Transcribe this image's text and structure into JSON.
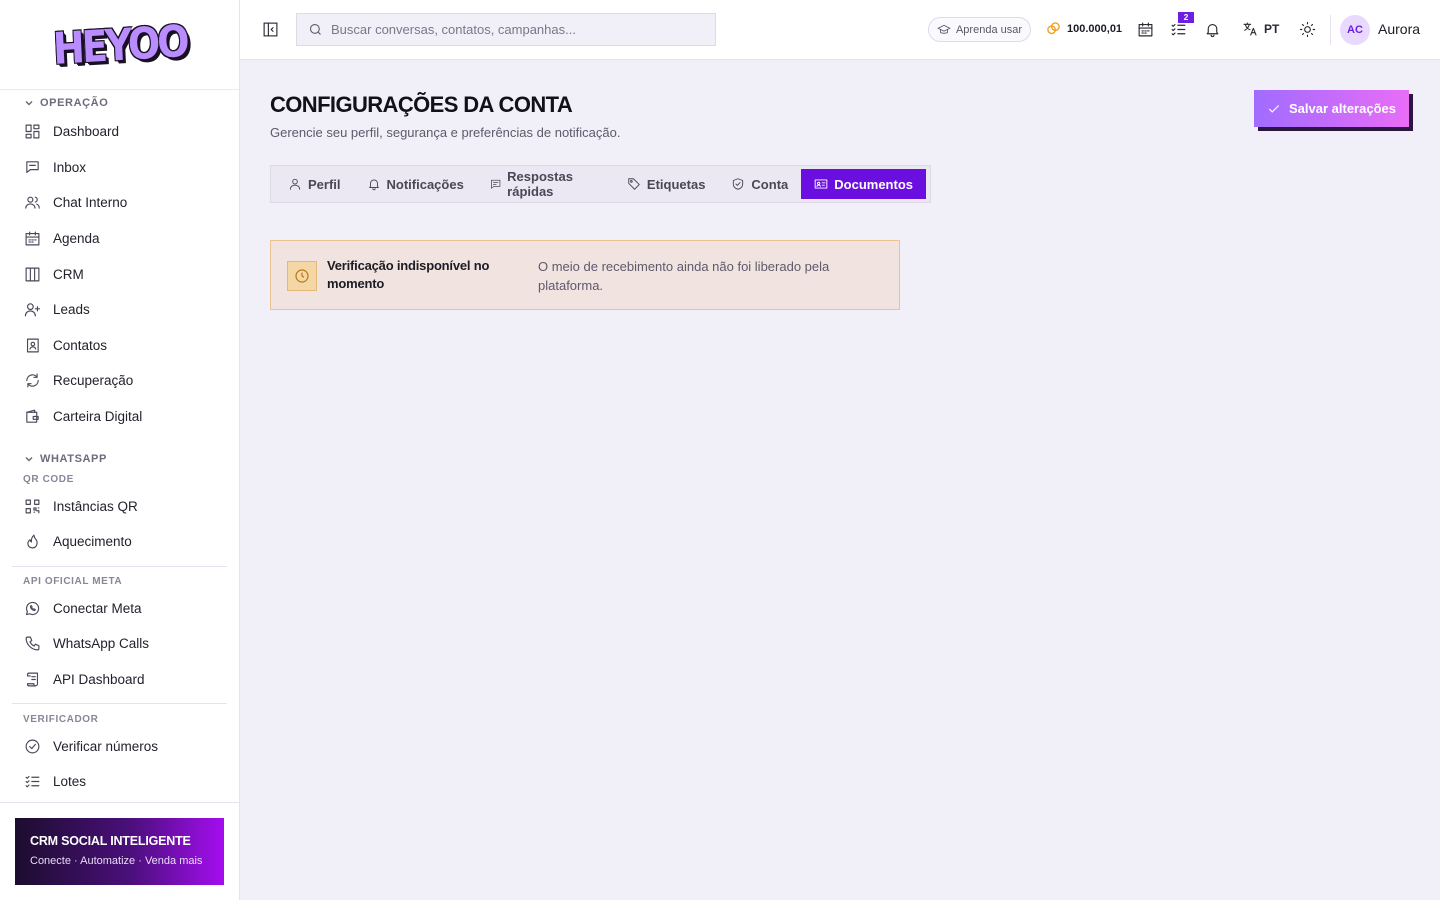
{
  "sidebar": {
    "logo_text": "HEYOO",
    "sections": {
      "operacao": "OPERAÇÃO",
      "whatsapp": "WHATSAPP",
      "qr_code": "QR CODE",
      "api_meta": "API OFICIAL META",
      "verificador": "VERIFICADOR"
    },
    "items": {
      "dashboard": "Dashboard",
      "inbox": "Inbox",
      "chat_interno": "Chat Interno",
      "agenda": "Agenda",
      "crm": "CRM",
      "leads": "Leads",
      "contatos": "Contatos",
      "recuperacao": "Recuperação",
      "carteira": "Carteira Digital",
      "instancias": "Instâncias QR",
      "aquecimento": "Aquecimento",
      "conectar_meta": "Conectar Meta",
      "whatsapp_calls": "WhatsApp Calls",
      "api_dashboard": "API Dashboard",
      "verificar": "Verificar números",
      "lotes": "Lotes"
    },
    "promo": {
      "title": "CRM SOCIAL INTELIGENTE",
      "subtitle": "Conecte · Automatize · Venda mais"
    }
  },
  "topbar": {
    "search_placeholder": "Buscar conversas, contatos, campanhas...",
    "learn_label": "Aprenda usar",
    "coins": "100.000,01",
    "tasks_badge": "2",
    "language": "PT",
    "user_initials": "AC",
    "user_name": "Aurora"
  },
  "page": {
    "title": "CONFIGURAÇÕES DA CONTA",
    "subtitle": "Gerencie seu perfil, segurança e preferências de notificação.",
    "save_label": "Salvar alterações",
    "tabs": {
      "perfil": "Perfil",
      "notificacoes": "Notificações",
      "respostas": "Respostas rápidas",
      "etiquetas": "Etiquetas",
      "conta": "Conta",
      "documentos": "Documentos"
    },
    "active_tab": "Documentos",
    "alert": {
      "title": "Verificação indisponível no momento",
      "text": "O meio de recebimento ainda não foi liberado pela plataforma."
    }
  },
  "colors": {
    "accent": "#6b0fe0",
    "background": "#f1eff8",
    "warning_border": "#ecc38f"
  }
}
